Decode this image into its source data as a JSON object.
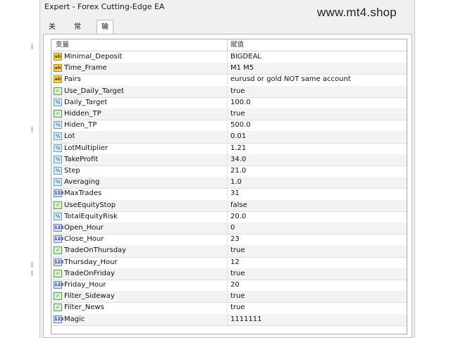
{
  "window": {
    "title": "Expert - Forex Cutting-Edge EA",
    "watermark": "www.mt4.shop"
  },
  "tabs": [
    {
      "label": "关于",
      "active": false
    },
    {
      "label": "常用",
      "active": false
    },
    {
      "label": "输入参数",
      "active": true
    }
  ],
  "grid": {
    "col_variable": "变量",
    "col_value": "赋值"
  },
  "params": [
    {
      "icon": "ab",
      "icon_text": "ab",
      "name": "Minimal_Deposit",
      "value": "BIGDEAL"
    },
    {
      "icon": "ab",
      "icon_text": "ab",
      "name": "Time_Frame",
      "value": "M1 M5"
    },
    {
      "icon": "ab",
      "icon_text": "ab",
      "name": "Pairs",
      "value": "eurusd or gold NOT same account"
    },
    {
      "icon": "bool",
      "icon_text": "✓",
      "name": "Use_Daily_Target",
      "value": "true"
    },
    {
      "icon": "dbl",
      "icon_text": "½",
      "name": "Daily_Target",
      "value": "100.0"
    },
    {
      "icon": "bool",
      "icon_text": "✓",
      "name": "Hidden_TP",
      "value": "true"
    },
    {
      "icon": "dbl",
      "icon_text": "½",
      "name": "Hiden_TP",
      "value": "500.0"
    },
    {
      "icon": "dbl",
      "icon_text": "½",
      "name": "Lot",
      "value": "0.01"
    },
    {
      "icon": "dbl",
      "icon_text": "½",
      "name": "LotMultiplier",
      "value": "1.21"
    },
    {
      "icon": "dbl",
      "icon_text": "½",
      "name": "TakeProfit",
      "value": "34.0"
    },
    {
      "icon": "dbl",
      "icon_text": "½",
      "name": "Step",
      "value": "21.0"
    },
    {
      "icon": "dbl",
      "icon_text": "½",
      "name": "Averaging",
      "value": "1.0"
    },
    {
      "icon": "int",
      "icon_text": "123",
      "name": "MaxTrades",
      "value": "31"
    },
    {
      "icon": "bool",
      "icon_text": "✓",
      "name": "UseEquityStop",
      "value": "false"
    },
    {
      "icon": "dbl",
      "icon_text": "½",
      "name": "TotalEquityRisk",
      "value": "20.0"
    },
    {
      "icon": "int",
      "icon_text": "123",
      "name": "Open_Hour",
      "value": "0"
    },
    {
      "icon": "int",
      "icon_text": "123",
      "name": "Close_Hour",
      "value": "23"
    },
    {
      "icon": "bool",
      "icon_text": "✓",
      "name": "TradeOnThursday",
      "value": "true"
    },
    {
      "icon": "int",
      "icon_text": "123",
      "name": "Thursday_Hour",
      "value": "12"
    },
    {
      "icon": "bool",
      "icon_text": "✓",
      "name": "TradeOnFriday",
      "value": "true"
    },
    {
      "icon": "int",
      "icon_text": "123",
      "name": "Friday_Hour",
      "value": "20"
    },
    {
      "icon": "bool",
      "icon_text": "✓",
      "name": "Filter_Sideway",
      "value": "true"
    },
    {
      "icon": "bool",
      "icon_text": "✓",
      "name": "Filter_News",
      "value": "true"
    },
    {
      "icon": "int",
      "icon_text": "123",
      "name": "Magic",
      "value": "1111111"
    }
  ]
}
